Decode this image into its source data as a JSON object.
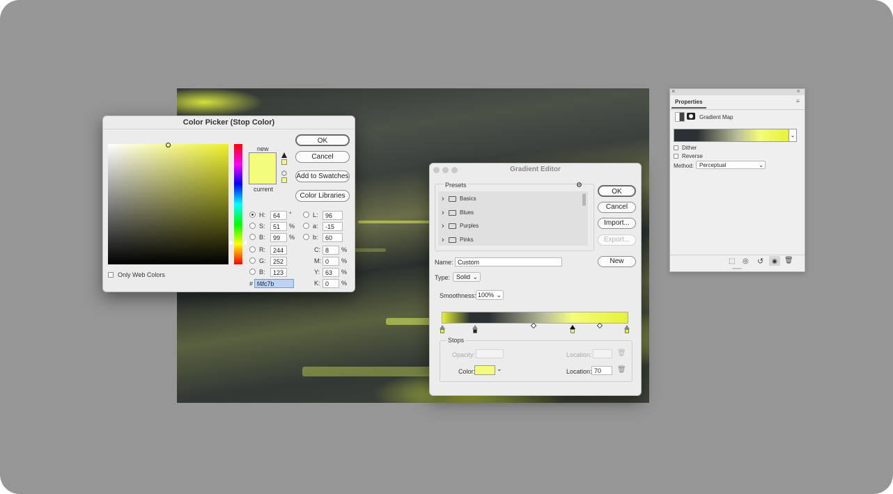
{
  "colors": {
    "new_color": "#f4fc7b",
    "current_color": "#f4fc7b",
    "hue_color": "#eef12a",
    "gradient_dark": "#2b3033",
    "gradient_light": "#e6f237"
  },
  "color_picker": {
    "title": "Color Picker (Stop Color)",
    "ok": "OK",
    "cancel": "Cancel",
    "add_to_swatches": "Add to Swatches",
    "color_libraries": "Color Libraries",
    "new_label": "new",
    "current_label": "current",
    "only_web_colors": "Only Web Colors",
    "fields": {
      "h": {
        "label": "H:",
        "value": "64",
        "unit": "°"
      },
      "s": {
        "label": "S:",
        "value": "51",
        "unit": "%"
      },
      "b": {
        "label": "B:",
        "value": "99",
        "unit": "%"
      },
      "r": {
        "label": "R:",
        "value": "244"
      },
      "g": {
        "label": "G:",
        "value": "252"
      },
      "bl": {
        "label": "B:",
        "value": "123"
      },
      "l": {
        "label": "L:",
        "value": "96"
      },
      "a": {
        "label": "a:",
        "value": "-15"
      },
      "lb": {
        "label": "b:",
        "value": "60"
      },
      "c": {
        "label": "C:",
        "value": "8",
        "unit": "%"
      },
      "m": {
        "label": "M:",
        "value": "0",
        "unit": "%"
      },
      "y": {
        "label": "Y:",
        "value": "63",
        "unit": "%"
      },
      "k": {
        "label": "K:",
        "value": "0",
        "unit": "%"
      }
    },
    "hex_label": "#",
    "hex_value": "f4fc7b"
  },
  "gradient_editor": {
    "title": "Gradient Editor",
    "presets_label": "Presets",
    "presets": [
      "Basics",
      "Blues",
      "Purples",
      "Pinks"
    ],
    "ok": "OK",
    "cancel": "Cancel",
    "import": "Import...",
    "export": "Export...",
    "new": "New",
    "name_label": "Name:",
    "name_value": "Custom",
    "type_label": "Type:",
    "type_value": "Solid",
    "smoothness_label": "Smoothness:",
    "smoothness_value": "100%",
    "stops_label": "Stops",
    "opacity_label": "Opacity:",
    "location_label": "Location:",
    "color_label": "Color:",
    "color_location_value": "70"
  },
  "properties": {
    "tab": "Properties",
    "layer_type": "Gradient Map",
    "dither": "Dither",
    "reverse": "Reverse",
    "method_label": "Method:",
    "method_value": "Perceptual"
  }
}
